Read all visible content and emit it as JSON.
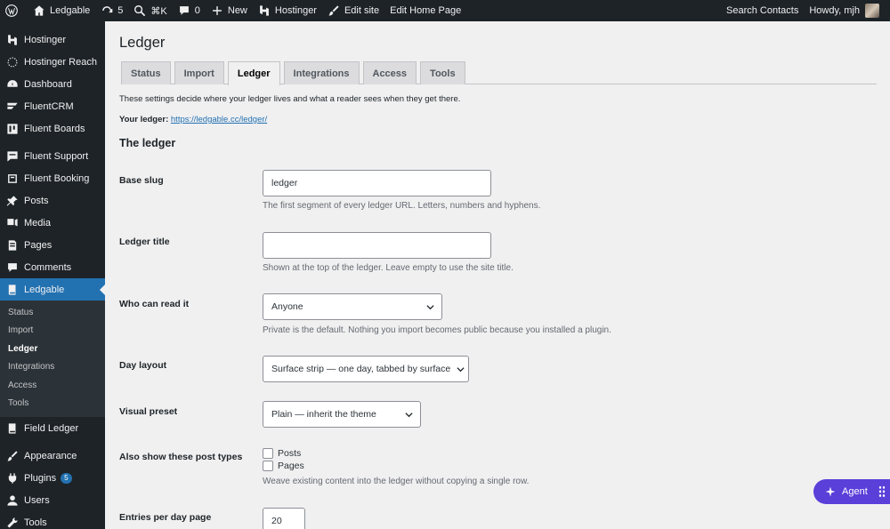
{
  "adminbar": {
    "site_name": "Ledgable",
    "updates_count": "5",
    "shortcut": "⌘K",
    "comments_count": "0",
    "new_label": "New",
    "hostinger_label": "Hostinger",
    "edit_site_label": "Edit site",
    "edit_home_label": "Edit Home Page",
    "search_contacts_label": "Search Contacts",
    "howdy_label": "Howdy, mjh"
  },
  "sidebar": {
    "items": [
      {
        "label": "Hostinger",
        "icon": "hostinger-icon"
      },
      {
        "label": "Hostinger Reach",
        "icon": "reach-icon"
      },
      {
        "label": "Dashboard",
        "icon": "dashboard-icon"
      },
      {
        "label": "FluentCRM",
        "icon": "fluentcrm-icon"
      },
      {
        "label": "Fluent Boards",
        "icon": "boards-icon"
      },
      {
        "label": "Fluent Support",
        "icon": "support-icon"
      },
      {
        "label": "Fluent Booking",
        "icon": "booking-icon"
      },
      {
        "label": "Posts",
        "icon": "pin-icon"
      },
      {
        "label": "Media",
        "icon": "media-icon"
      },
      {
        "label": "Pages",
        "icon": "pages-icon"
      },
      {
        "label": "Comments",
        "icon": "comment-icon"
      },
      {
        "label": "Ledgable",
        "icon": "book-icon"
      }
    ],
    "submenu": [
      "Status",
      "Import",
      "Ledger",
      "Integrations",
      "Access",
      "Tools"
    ],
    "after": [
      {
        "label": "Field Ledger",
        "icon": "book-icon"
      },
      {
        "label": "Appearance",
        "icon": "brush-icon"
      },
      {
        "label": "Plugins",
        "icon": "plugin-icon",
        "badge": "5"
      },
      {
        "label": "Users",
        "icon": "user-icon"
      },
      {
        "label": "Tools",
        "icon": "wrench-icon"
      }
    ]
  },
  "page": {
    "title": "Ledger",
    "tabs": [
      "Status",
      "Import",
      "Ledger",
      "Integrations",
      "Access",
      "Tools"
    ],
    "intro": "These settings decide where your ledger lives and what a reader sees when they get there.",
    "your_ledger_label": "Your ledger:",
    "your_ledger_url": "https://ledgable.cc/ledger/",
    "section_title": "The ledger"
  },
  "fields": {
    "base_slug": {
      "label": "Base slug",
      "value": "ledger",
      "desc": "The first segment of every ledger URL. Letters, numbers and hyphens."
    },
    "ledger_title": {
      "label": "Ledger title",
      "value": "",
      "desc": "Shown at the top of the ledger. Leave empty to use the site title."
    },
    "who_can_read": {
      "label": "Who can read it",
      "value": "Anyone",
      "desc": "Private is the default. Nothing you import becomes public because you installed a plugin."
    },
    "day_layout": {
      "label": "Day layout",
      "value": "Surface strip — one day, tabbed by surface"
    },
    "visual_preset": {
      "label": "Visual preset",
      "value": "Plain — inherit the theme"
    },
    "post_types": {
      "label": "Also show these post types",
      "options": [
        "Posts",
        "Pages"
      ],
      "desc": "Weave existing content into the ledger without copying a single row."
    },
    "entries_per_day": {
      "label": "Entries per day page",
      "value": "20"
    }
  },
  "agent": {
    "label": "Agent"
  },
  "colors": {
    "accent": "#2271b1",
    "adminbar": "#1d2327",
    "agent": "#5b3fd9"
  }
}
